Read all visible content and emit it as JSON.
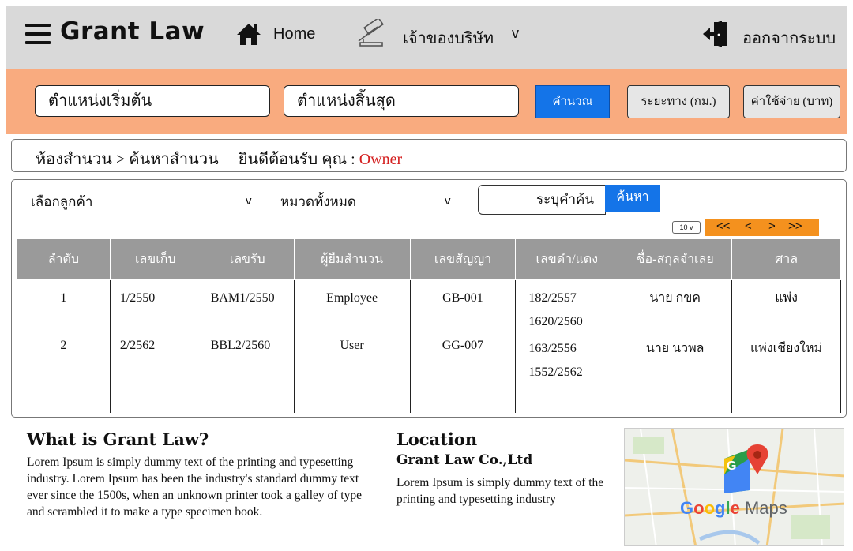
{
  "header": {
    "brand": "Grant Law",
    "home_label": "Home",
    "owner_label": "เจ้าของบริษัท",
    "owner_chevron": "v",
    "logout_label": "ออกจากระบบ",
    "icons": [
      "hamburger-icon",
      "home-icon",
      "gavel-icon",
      "logout-icon"
    ]
  },
  "route_bar": {
    "start_label": "ตำแหน่งเริ่มต้น",
    "end_label": "ตำแหน่งสิ้นสุด",
    "calculate_label": "คำนวณ",
    "distance_label": "ระยะทาง (กม.)",
    "cost_label": "ค่าใช้จ่าย (บาท)"
  },
  "breadcrumb": {
    "path": "ห้องสำนวน > ค้นหาสำนวน",
    "welcome": "ยินดีต้อนรับ คุณ :",
    "user": "Owner"
  },
  "filters": {
    "customer_label": "เลือกลูกค้า",
    "customer_chevron": "v",
    "category_label": "หมวดทั้งหมด",
    "category_chevron": "v",
    "search_placeholder": "ระบุคำค้น",
    "search_button": "ค้นหา",
    "page_size": "10 v",
    "pager": {
      "first": "<<",
      "prev": "<",
      "next": ">",
      "last": ">>"
    }
  },
  "table": {
    "columns": [
      "ลำดับ",
      "เลขเก็บ",
      "เลขรับ",
      "ผู้ยืมสำนวน",
      "เลขสัญญา",
      "เลขดำ/แดง",
      "ชื่อ-สกุลจำเลย",
      "ศาล"
    ],
    "rows": [
      {
        "no": "1",
        "store_no": "1/2550",
        "receive_no": "BAM1/2550",
        "borrower": "Employee",
        "contract_no": "GB-001",
        "case_no_1": "182/2557",
        "case_no_2": "1620/2560",
        "defendant": "นาย กขค",
        "court": "แพ่ง"
      },
      {
        "no": "2",
        "store_no": "2/2562",
        "receive_no": "BBL2/2560",
        "borrower": "User",
        "contract_no": "GG-007",
        "case_no_1": "163/2556",
        "case_no_2": "1552/2562",
        "defendant": "นาย นวพล",
        "court": "แพ่งเชียงใหม่"
      }
    ]
  },
  "about": {
    "title": "What is Grant Law?",
    "text": "Lorem Ipsum is simply dummy text of the printing and typesetting industry. Lorem Ipsum has been the industry's standard dummy text ever since the 1500s, when an unknown printer took a galley of type and scrambled it to make a type specimen book."
  },
  "location": {
    "title": "Location",
    "company": "Grant Law Co.,Ltd",
    "text": "Lorem Ipsum is simply dummy text of the printing and typesetting industry"
  },
  "map": {
    "label": "Google Maps"
  },
  "colors": {
    "header_bg": "#d9d9d9",
    "route_bar_bg": "#f9ab7f",
    "primary_blue": "#1474e8",
    "pager_orange": "#f4911e",
    "table_header_bg": "#9a9a9a",
    "accent_red": "#d42020"
  }
}
